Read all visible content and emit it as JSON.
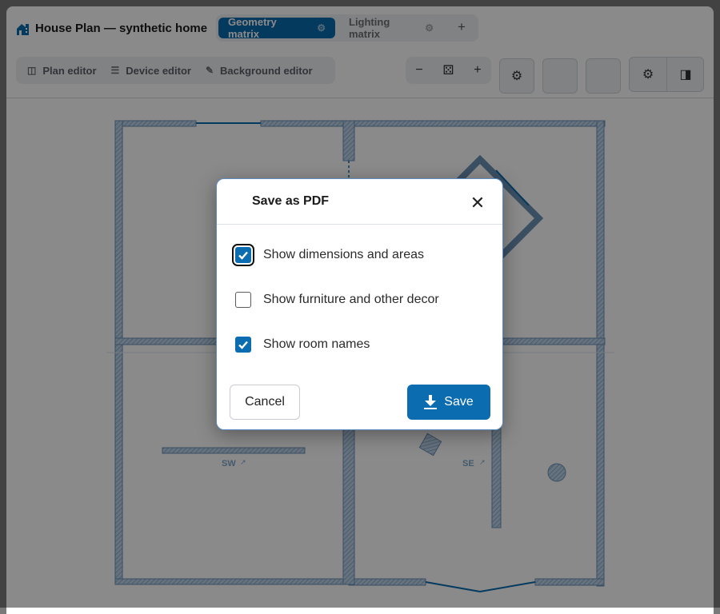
{
  "app": {
    "title": "House Plan — synthetic home",
    "icon": "house-plan-icon"
  },
  "tabs": [
    {
      "label": "Geometry matrix",
      "active": true,
      "icon": "gear-icon"
    },
    {
      "label": "Lighting matrix",
      "active": false,
      "icon": "gear-icon"
    }
  ],
  "tab_add": "+",
  "modes": [
    {
      "label": "Plan editor",
      "icon": "floorplan-icon"
    },
    {
      "label": "Device editor",
      "icon": "sliders-icon"
    },
    {
      "label": "Background editor",
      "icon": "brush-icon"
    }
  ],
  "zoom": {
    "out": "−",
    "fit": "⚄",
    "in": "+"
  },
  "toolbar_icons": [
    "gear-icon",
    "panel-right-icon"
  ],
  "rooms": [
    {
      "label": "SW",
      "icon": "external-link-icon"
    },
    {
      "label": "SE",
      "icon": "external-link-icon"
    }
  ],
  "dialog": {
    "title": "Save as PDF",
    "close": "✕",
    "options": [
      {
        "label": "Show dimensions and areas",
        "checked": true
      },
      {
        "label": "Show furniture and other decor",
        "checked": false
      },
      {
        "label": "Show room names",
        "checked": true
      }
    ],
    "cancel_label": "Cancel",
    "save_label": "Save"
  },
  "colors": {
    "accent": "#0b6cb0",
    "wall": "#a9c4de",
    "overlay": "rgba(0,0,0,0.46)"
  }
}
